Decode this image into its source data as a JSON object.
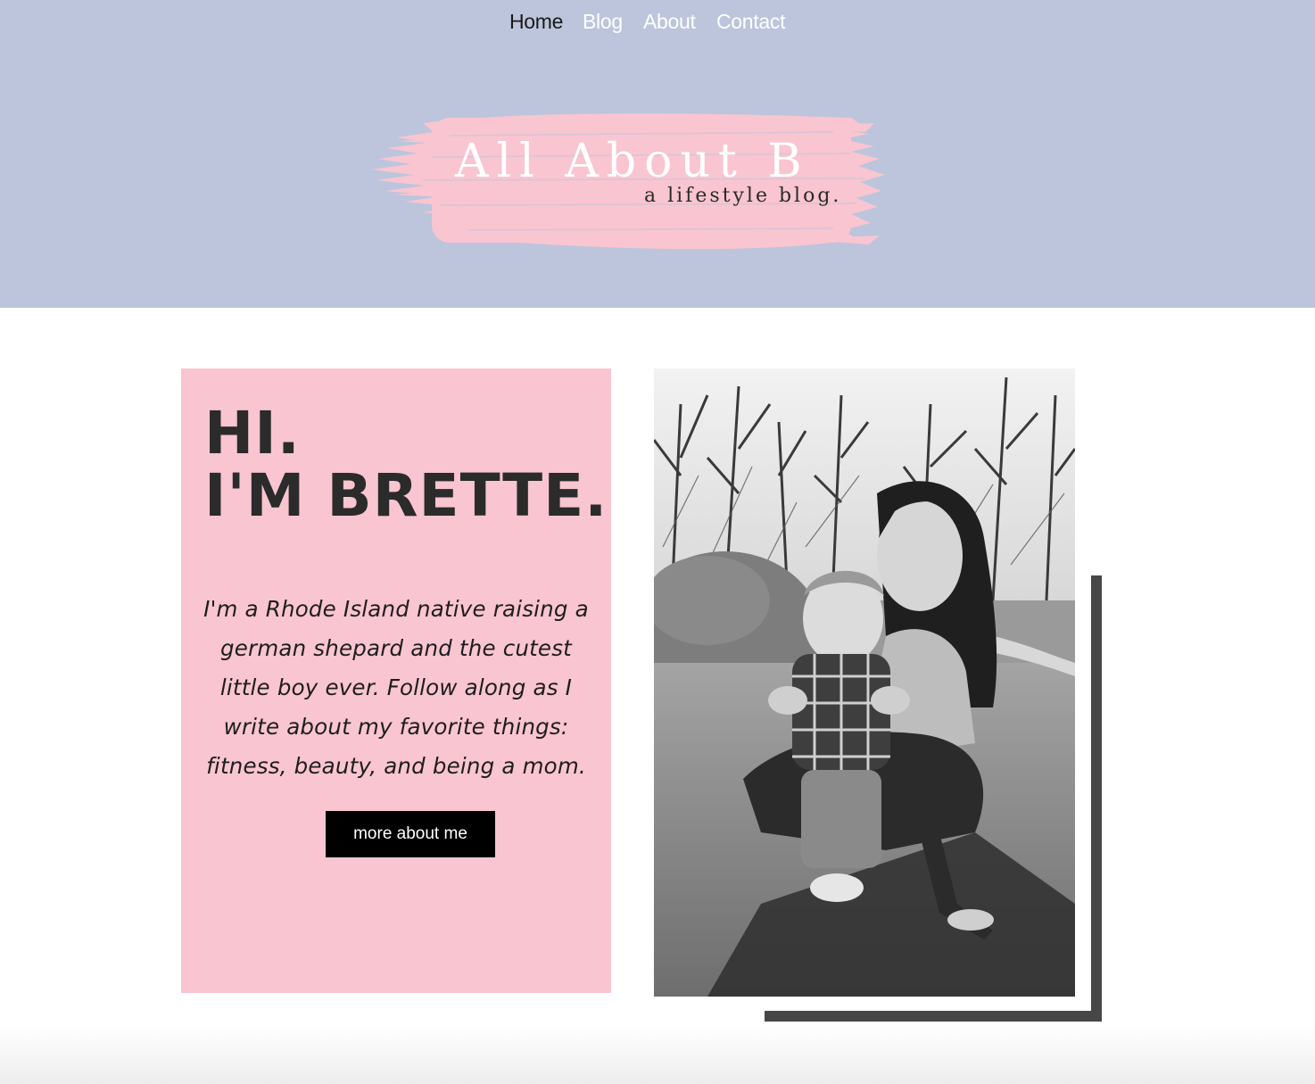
{
  "nav": {
    "items": [
      {
        "label": "Home",
        "active": true
      },
      {
        "label": "Blog",
        "active": false
      },
      {
        "label": "About",
        "active": false
      },
      {
        "label": "Contact",
        "active": false
      }
    ]
  },
  "logo": {
    "title": "All About B",
    "subtitle": "a lifestyle blog."
  },
  "intro": {
    "greeting_line1": "HI.",
    "greeting_line2": "I'M BRETTE.",
    "bio": "I'm a Rhode Island native raising a german shepard and the cutest little boy ever. Follow along as I write about my favorite things: fitness, beauty, and being a mom.",
    "button_label": "more about me"
  },
  "colors": {
    "header_bg": "#bcc5dc",
    "brush": "#f9c5d0",
    "card_bg": "#f9c5d0",
    "button_bg": "#000000",
    "shadow": "#474747"
  },
  "photo": {
    "style": "black-and-white"
  }
}
